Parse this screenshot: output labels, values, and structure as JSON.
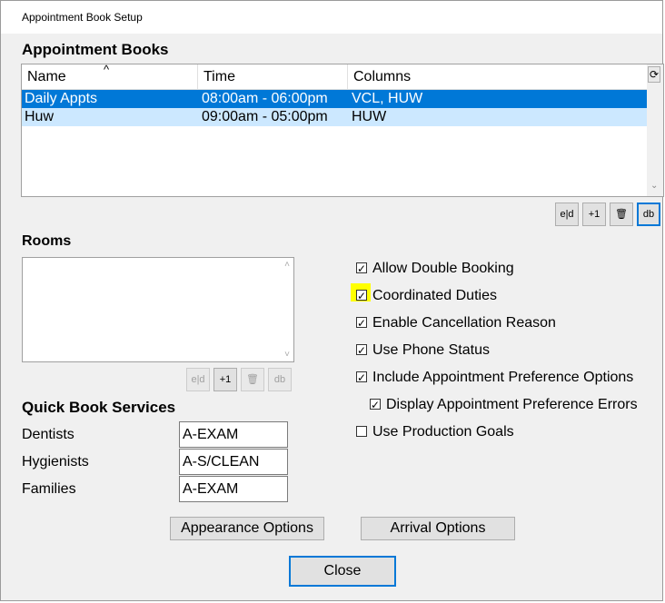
{
  "window": {
    "title": "Appointment Book Setup"
  },
  "appointment_books": {
    "heading": "Appointment Books",
    "columns": [
      "Name",
      "Time",
      "Columns"
    ],
    "sort_indicator": "^",
    "rows": [
      {
        "name": "Daily Appts",
        "time": "08:00am - 06:00pm",
        "columns": "VCL, HUW",
        "selected": true
      },
      {
        "name": "Huw",
        "time": "09:00am - 05:00pm",
        "columns": "HUW",
        "selected": false
      }
    ],
    "toolbar": {
      "edit": "e|d",
      "add": "+1",
      "delete": "🗑",
      "db": "db"
    }
  },
  "rooms": {
    "heading": "Rooms",
    "toolbar": {
      "edit": "e|d",
      "add": "+1",
      "delete": "🗑",
      "db": "db"
    }
  },
  "options": [
    {
      "label": "Allow Double Booking",
      "checked": true
    },
    {
      "label": "Coordinated Duties",
      "checked": true
    },
    {
      "label": "Enable Cancellation Reason",
      "checked": true
    },
    {
      "label": "Use Phone Status",
      "checked": true
    },
    {
      "label": "Include Appointment Preference Options",
      "checked": true
    },
    {
      "label": "Display Appointment Preference Errors",
      "checked": true
    },
    {
      "label": "Use Production Goals",
      "checked": false
    }
  ],
  "quick_book": {
    "heading": "Quick Book Services",
    "fields": [
      {
        "label": "Dentists",
        "value": "A-EXAM"
      },
      {
        "label": "Hygienists",
        "value": "A-S/CLEAN"
      },
      {
        "label": "Families",
        "value": "A-EXAM"
      }
    ]
  },
  "buttons": {
    "appearance": "Appearance Options",
    "arrival": "Arrival Options",
    "close": "Close"
  },
  "colors": {
    "selection": "#0078d7",
    "alt_row": "#cce8ff",
    "highlight": "#ffff00"
  }
}
